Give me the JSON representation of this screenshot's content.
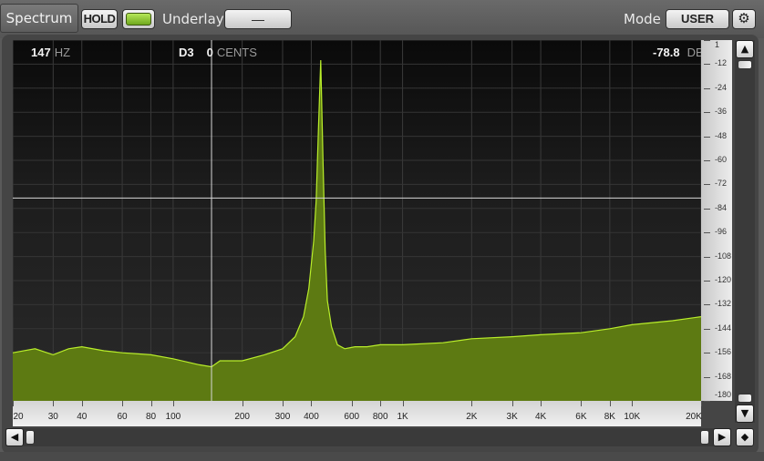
{
  "panel": {
    "title": "Spectrum",
    "hold_label": "HOLD",
    "underlay_label": "Underlay",
    "underlay_value": "—",
    "mode_label": "Mode",
    "mode_value": "USER",
    "settings_icon": "⚙"
  },
  "readouts": {
    "freq_value": "147",
    "freq_unit": "HZ",
    "note": "D3",
    "cents_value": "0",
    "cents_unit": "CENTS",
    "level_value": "-78.8",
    "level_unit": "DB"
  },
  "colors": {
    "spectrum_fill": "#5d7a12",
    "spectrum_line": "#b9ee2a",
    "led_on": "#8cc63a"
  },
  "scroll": {
    "up_icon": "▲",
    "down_icon": "▼",
    "left_icon": "◀",
    "right_icon": "▶",
    "diamond_icon": "◆"
  },
  "chart_data": {
    "type": "area",
    "x_scale": "log",
    "xlim": [
      20,
      20000
    ],
    "ylim": [
      -180,
      0
    ],
    "x_tick_labels": [
      "20",
      "30",
      "40",
      "60",
      "80",
      "100",
      "200",
      "300",
      "400",
      "600",
      "800",
      "1K",
      "2K",
      "3K",
      "4K",
      "6K",
      "8K",
      "10K",
      "20K"
    ],
    "y_tick_labels": [
      "1",
      "-12",
      "-24",
      "-36",
      "-48",
      "-60",
      "-72",
      "-84",
      "-96",
      "-108",
      "-120",
      "-132",
      "-144",
      "-156",
      "-168",
      "-180"
    ],
    "cursor": {
      "freq_hz": 147,
      "level_db": -78.8
    },
    "series": [
      {
        "x": [
          20,
          25,
          30,
          35,
          40,
          50,
          60,
          80,
          100,
          130,
          147,
          160,
          200,
          250,
          300,
          340,
          370,
          390,
          410,
          420,
          430,
          440,
          450,
          460,
          470,
          490,
          520,
          560,
          620,
          700,
          800,
          1000,
          1500,
          2000,
          3000,
          4000,
          6000,
          8000,
          10000,
          15000,
          20000
        ],
        "y": [
          -156,
          -154,
          -157,
          -154,
          -153,
          -155,
          -156,
          -157,
          -159,
          -162,
          -163,
          -160,
          -160,
          -157,
          -154,
          -148,
          -138,
          -124,
          -100,
          -80,
          -44,
          -10,
          -60,
          -105,
          -130,
          -143,
          -152,
          -154,
          -153,
          -153,
          -152,
          -152,
          -151,
          -149,
          -148,
          -147,
          -146,
          -144,
          -142,
          -140,
          -138
        ]
      }
    ]
  }
}
